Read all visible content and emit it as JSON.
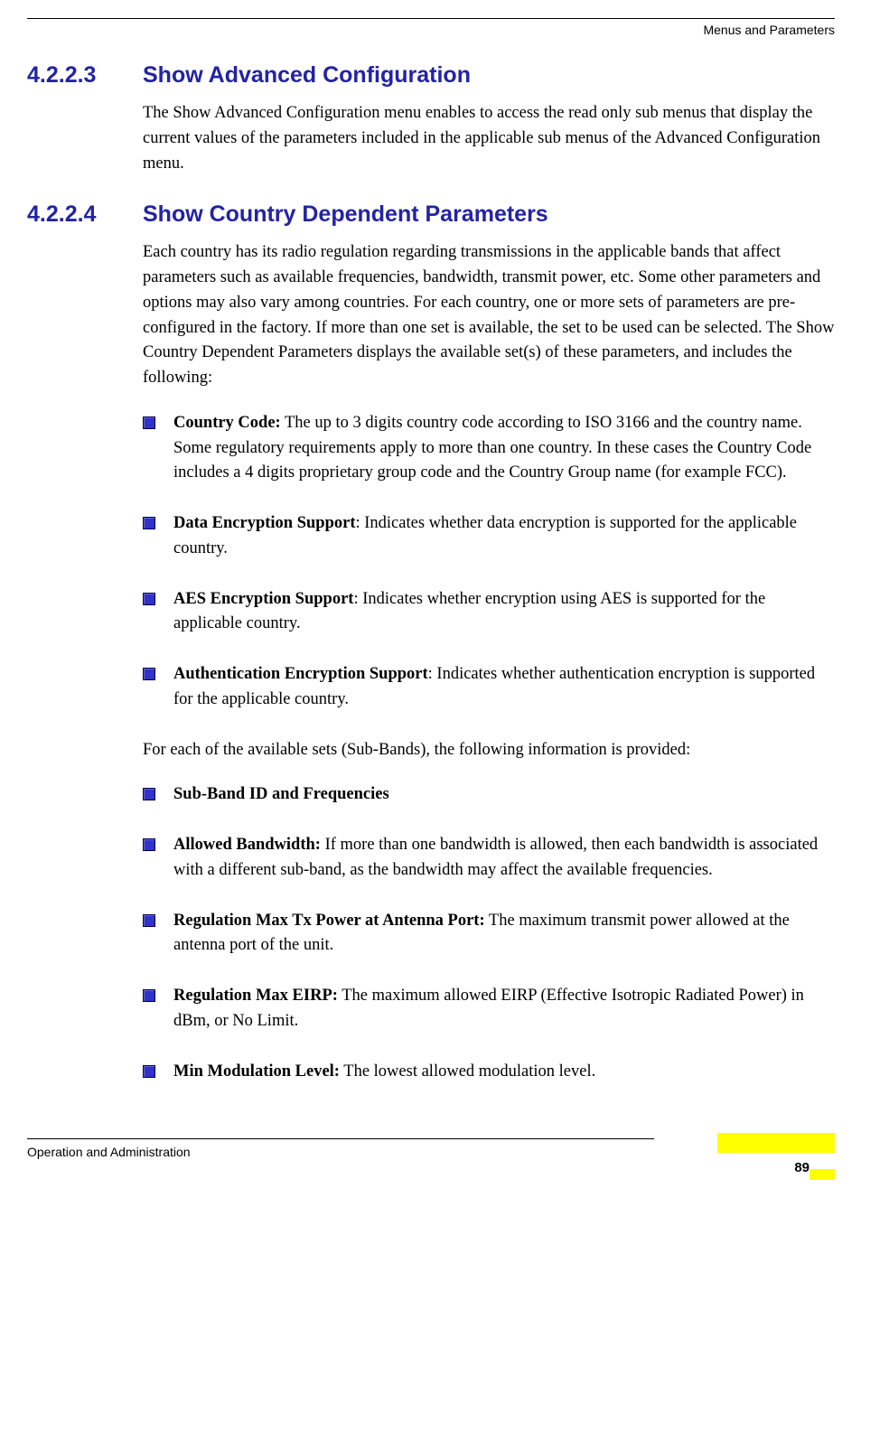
{
  "header": {
    "right": "Menus and Parameters"
  },
  "sections": {
    "s1": {
      "number": "4.2.2.3",
      "title": "Show Advanced Configuration",
      "para": "The Show Advanced Configuration menu enables to access the read only sub menus that display the current values of the parameters included in the applicable sub menus of the Advanced Configuration menu."
    },
    "s2": {
      "number": "4.2.2.4",
      "title": "Show Country Dependent Parameters",
      "para": "Each country has its radio regulation regarding transmissions in the applicable bands that affect parameters such as available frequencies, bandwidth, transmit power, etc. Some other parameters and options may also vary among countries. For each country, one or more sets of parameters are pre-configured in the factory. If more than one set is available, the set to be used can be selected. The Show Country Dependent Parameters displays the available set(s) of these parameters, and includes the following:",
      "bullets1": {
        "b1": {
          "label": "Country Code:",
          "text": " The up to 3 digits country code according to ISO 3166 and the country name. Some regulatory requirements apply to more than one country. In these cases the Country Code includes a 4 digits proprietary group code and the Country Group name (for example FCC)."
        },
        "b2": {
          "label": "Data Encryption Support",
          "text": ": Indicates whether data encryption is supported for the applicable country."
        },
        "b3": {
          "label": "AES Encryption Support",
          "text": ": Indicates whether encryption using AES is supported for the applicable country."
        },
        "b4": {
          "label": "Authentication Encryption Support",
          "text": ": Indicates whether authentication encryption is supported for the applicable country."
        }
      },
      "mid": "For each of the available sets (Sub-Bands), the following information is provided:",
      "bullets2": {
        "b1": {
          "label": "Sub-Band ID and Frequencies",
          "text": ""
        },
        "b2": {
          "label": "Allowed Bandwidth:",
          "text": " If more than one bandwidth is allowed, then each bandwidth is associated with a different sub-band, as the bandwidth may affect the available frequencies."
        },
        "b3": {
          "label": "Regulation Max Tx Power at Antenna Port:",
          "text": " The maximum transmit power allowed at the antenna port of the unit."
        },
        "b4": {
          "label": "Regulation Max EIRP:",
          "text": " The maximum allowed EIRP (Effective Isotropic Radiated Power) in dBm, or No Limit."
        },
        "b5": {
          "label": "Min Modulation Level:",
          "text": " The lowest allowed modulation level."
        }
      }
    }
  },
  "footer": {
    "left": "Operation and Administration",
    "page": "89"
  }
}
